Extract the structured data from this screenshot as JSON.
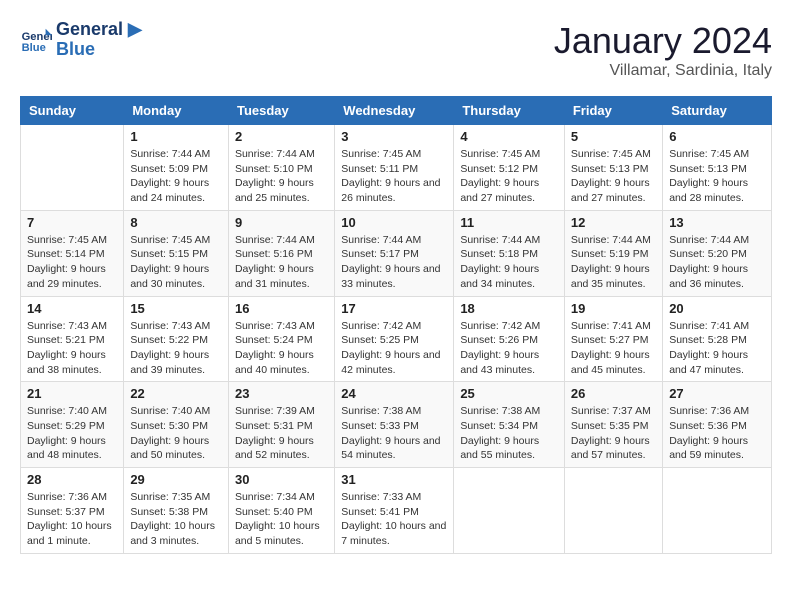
{
  "header": {
    "logo_line1": "General",
    "logo_line2": "Blue",
    "month": "January 2024",
    "location": "Villamar, Sardinia, Italy"
  },
  "weekdays": [
    "Sunday",
    "Monday",
    "Tuesday",
    "Wednesday",
    "Thursday",
    "Friday",
    "Saturday"
  ],
  "weeks": [
    [
      {
        "day": "",
        "sunrise": "",
        "sunset": "",
        "daylight": ""
      },
      {
        "day": "1",
        "sunrise": "Sunrise: 7:44 AM",
        "sunset": "Sunset: 5:09 PM",
        "daylight": "Daylight: 9 hours and 24 minutes."
      },
      {
        "day": "2",
        "sunrise": "Sunrise: 7:44 AM",
        "sunset": "Sunset: 5:10 PM",
        "daylight": "Daylight: 9 hours and 25 minutes."
      },
      {
        "day": "3",
        "sunrise": "Sunrise: 7:45 AM",
        "sunset": "Sunset: 5:11 PM",
        "daylight": "Daylight: 9 hours and 26 minutes."
      },
      {
        "day": "4",
        "sunrise": "Sunrise: 7:45 AM",
        "sunset": "Sunset: 5:12 PM",
        "daylight": "Daylight: 9 hours and 27 minutes."
      },
      {
        "day": "5",
        "sunrise": "Sunrise: 7:45 AM",
        "sunset": "Sunset: 5:13 PM",
        "daylight": "Daylight: 9 hours and 27 minutes."
      },
      {
        "day": "6",
        "sunrise": "Sunrise: 7:45 AM",
        "sunset": "Sunset: 5:13 PM",
        "daylight": "Daylight: 9 hours and 28 minutes."
      }
    ],
    [
      {
        "day": "7",
        "sunrise": "Sunrise: 7:45 AM",
        "sunset": "Sunset: 5:14 PM",
        "daylight": "Daylight: 9 hours and 29 minutes."
      },
      {
        "day": "8",
        "sunrise": "Sunrise: 7:45 AM",
        "sunset": "Sunset: 5:15 PM",
        "daylight": "Daylight: 9 hours and 30 minutes."
      },
      {
        "day": "9",
        "sunrise": "Sunrise: 7:44 AM",
        "sunset": "Sunset: 5:16 PM",
        "daylight": "Daylight: 9 hours and 31 minutes."
      },
      {
        "day": "10",
        "sunrise": "Sunrise: 7:44 AM",
        "sunset": "Sunset: 5:17 PM",
        "daylight": "Daylight: 9 hours and 33 minutes."
      },
      {
        "day": "11",
        "sunrise": "Sunrise: 7:44 AM",
        "sunset": "Sunset: 5:18 PM",
        "daylight": "Daylight: 9 hours and 34 minutes."
      },
      {
        "day": "12",
        "sunrise": "Sunrise: 7:44 AM",
        "sunset": "Sunset: 5:19 PM",
        "daylight": "Daylight: 9 hours and 35 minutes."
      },
      {
        "day": "13",
        "sunrise": "Sunrise: 7:44 AM",
        "sunset": "Sunset: 5:20 PM",
        "daylight": "Daylight: 9 hours and 36 minutes."
      }
    ],
    [
      {
        "day": "14",
        "sunrise": "Sunrise: 7:43 AM",
        "sunset": "Sunset: 5:21 PM",
        "daylight": "Daylight: 9 hours and 38 minutes."
      },
      {
        "day": "15",
        "sunrise": "Sunrise: 7:43 AM",
        "sunset": "Sunset: 5:22 PM",
        "daylight": "Daylight: 9 hours and 39 minutes."
      },
      {
        "day": "16",
        "sunrise": "Sunrise: 7:43 AM",
        "sunset": "Sunset: 5:24 PM",
        "daylight": "Daylight: 9 hours and 40 minutes."
      },
      {
        "day": "17",
        "sunrise": "Sunrise: 7:42 AM",
        "sunset": "Sunset: 5:25 PM",
        "daylight": "Daylight: 9 hours and 42 minutes."
      },
      {
        "day": "18",
        "sunrise": "Sunrise: 7:42 AM",
        "sunset": "Sunset: 5:26 PM",
        "daylight": "Daylight: 9 hours and 43 minutes."
      },
      {
        "day": "19",
        "sunrise": "Sunrise: 7:41 AM",
        "sunset": "Sunset: 5:27 PM",
        "daylight": "Daylight: 9 hours and 45 minutes."
      },
      {
        "day": "20",
        "sunrise": "Sunrise: 7:41 AM",
        "sunset": "Sunset: 5:28 PM",
        "daylight": "Daylight: 9 hours and 47 minutes."
      }
    ],
    [
      {
        "day": "21",
        "sunrise": "Sunrise: 7:40 AM",
        "sunset": "Sunset: 5:29 PM",
        "daylight": "Daylight: 9 hours and 48 minutes."
      },
      {
        "day": "22",
        "sunrise": "Sunrise: 7:40 AM",
        "sunset": "Sunset: 5:30 PM",
        "daylight": "Daylight: 9 hours and 50 minutes."
      },
      {
        "day": "23",
        "sunrise": "Sunrise: 7:39 AM",
        "sunset": "Sunset: 5:31 PM",
        "daylight": "Daylight: 9 hours and 52 minutes."
      },
      {
        "day": "24",
        "sunrise": "Sunrise: 7:38 AM",
        "sunset": "Sunset: 5:33 PM",
        "daylight": "Daylight: 9 hours and 54 minutes."
      },
      {
        "day": "25",
        "sunrise": "Sunrise: 7:38 AM",
        "sunset": "Sunset: 5:34 PM",
        "daylight": "Daylight: 9 hours and 55 minutes."
      },
      {
        "day": "26",
        "sunrise": "Sunrise: 7:37 AM",
        "sunset": "Sunset: 5:35 PM",
        "daylight": "Daylight: 9 hours and 57 minutes."
      },
      {
        "day": "27",
        "sunrise": "Sunrise: 7:36 AM",
        "sunset": "Sunset: 5:36 PM",
        "daylight": "Daylight: 9 hours and 59 minutes."
      }
    ],
    [
      {
        "day": "28",
        "sunrise": "Sunrise: 7:36 AM",
        "sunset": "Sunset: 5:37 PM",
        "daylight": "Daylight: 10 hours and 1 minute."
      },
      {
        "day": "29",
        "sunrise": "Sunrise: 7:35 AM",
        "sunset": "Sunset: 5:38 PM",
        "daylight": "Daylight: 10 hours and 3 minutes."
      },
      {
        "day": "30",
        "sunrise": "Sunrise: 7:34 AM",
        "sunset": "Sunset: 5:40 PM",
        "daylight": "Daylight: 10 hours and 5 minutes."
      },
      {
        "day": "31",
        "sunrise": "Sunrise: 7:33 AM",
        "sunset": "Sunset: 5:41 PM",
        "daylight": "Daylight: 10 hours and 7 minutes."
      },
      {
        "day": "",
        "sunrise": "",
        "sunset": "",
        "daylight": ""
      },
      {
        "day": "",
        "sunrise": "",
        "sunset": "",
        "daylight": ""
      },
      {
        "day": "",
        "sunrise": "",
        "sunset": "",
        "daylight": ""
      }
    ]
  ]
}
